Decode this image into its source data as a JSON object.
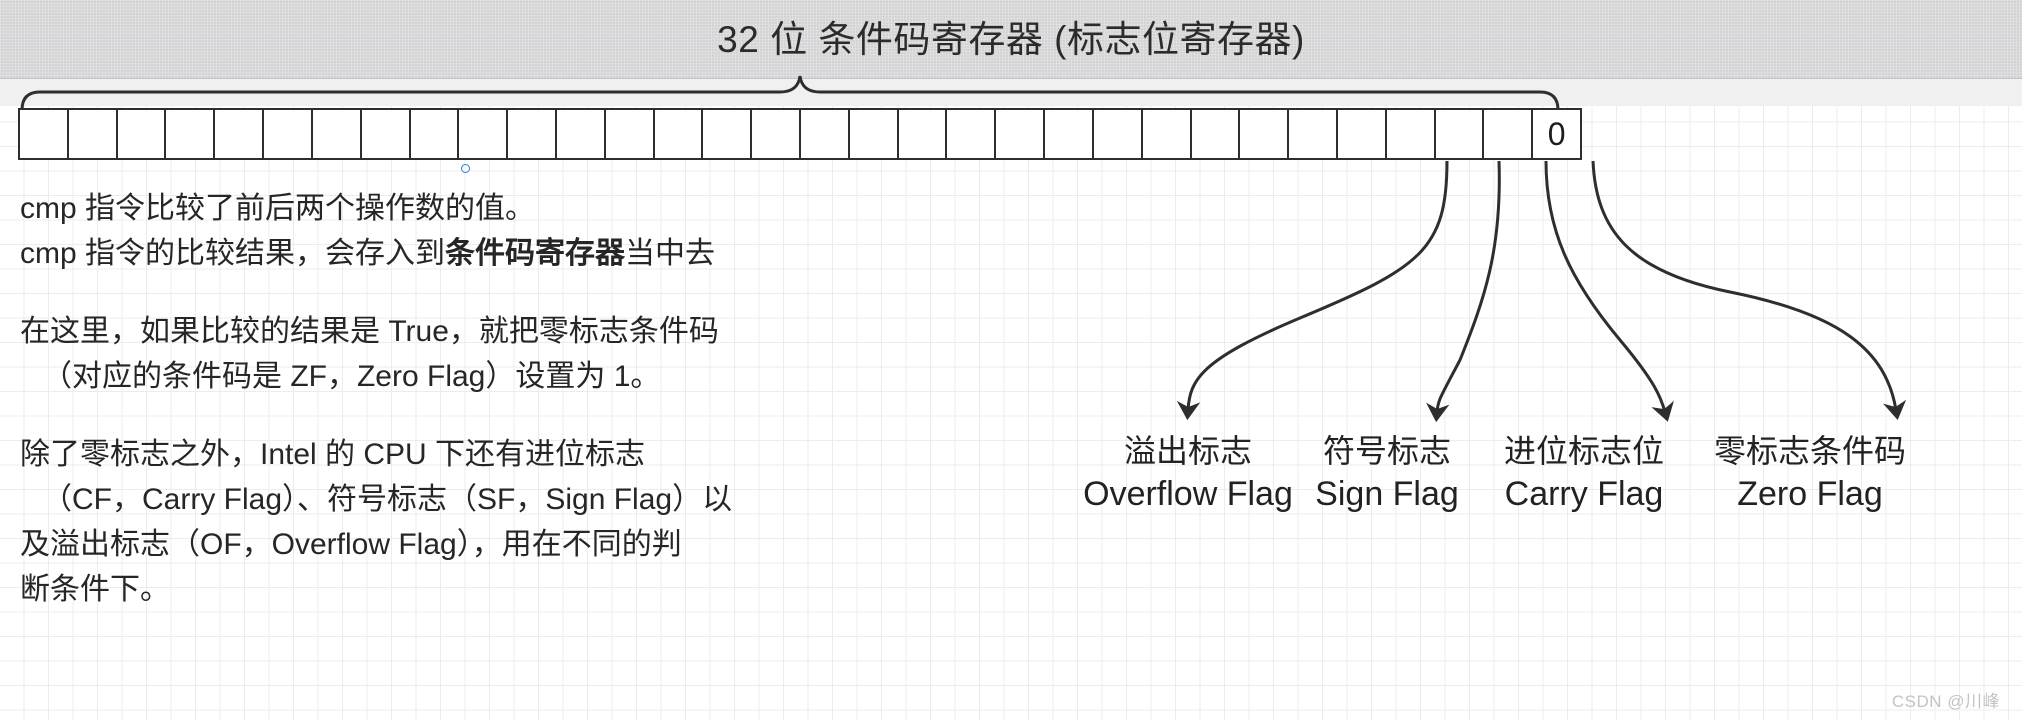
{
  "header": {
    "title": "32 位 条件码寄存器 (标志位寄存器)"
  },
  "register": {
    "bit_count": 32,
    "cells": [
      "",
      "",
      "",
      "",
      "",
      "",
      "",
      "",
      "",
      "",
      "",
      "",
      "",
      "",
      "",
      "",
      "",
      "",
      "",
      "",
      "",
      "",
      "",
      "",
      "",
      "",
      "",
      "",
      "",
      "",
      "",
      "0"
    ],
    "lsb_value": "0"
  },
  "notes": {
    "paragraph1": {
      "line1": "cmp 指令比较了前后两个操作数的值。",
      "line2_prefix": "cmp 指令的比较结果，会存入到",
      "line2_bold": "条件码寄存器",
      "line2_suffix": "当中去"
    },
    "paragraph2": {
      "line1": "在这里，如果比较的结果是 True，就把零标志条件码",
      "line2": "（对应的条件码是 ZF，Zero Flag）设置为 1。"
    },
    "paragraph3": {
      "line1": "除了零标志之外，Intel 的 CPU 下还有进位标志",
      "line2": "（CF，Carry Flag）、符号标志（SF，Sign Flag）以",
      "line3": "及溢出标志（OF，Overflow Flag），用在不同的判",
      "line4": "断条件下。"
    }
  },
  "flags": [
    {
      "id": "overflow-flag",
      "cn": "溢出标志",
      "en": "Overflow Flag"
    },
    {
      "id": "sign-flag",
      "cn": "符号标志",
      "en": "Sign Flag"
    },
    {
      "id": "carry-flag",
      "cn": "进位标志位",
      "en": "Carry Flag"
    },
    {
      "id": "zero-flag",
      "cn": "零标志条件码",
      "en": "Zero Flag"
    }
  ],
  "watermark": "CSDN @川峰",
  "colors": {
    "header_band": "#d4d4d6",
    "stroke": "#2e2e2e",
    "text": "#262626",
    "marker_blue": "#2f7fd8",
    "watermark": "#c3c3c3"
  }
}
